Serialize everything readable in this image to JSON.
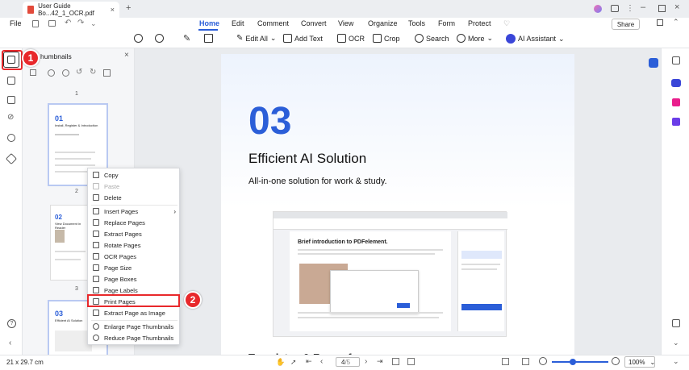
{
  "window": {
    "tab_title": "User Guide Bo...42_1_OCR.pdf"
  },
  "menubar": {
    "file": "File",
    "items": [
      "Home",
      "Edit",
      "Comment",
      "Convert",
      "View",
      "Organize",
      "Tools",
      "Form",
      "Protect"
    ],
    "active": "Home",
    "share": "Share"
  },
  "toolbar": {
    "edit_all": "Edit All",
    "add_text": "Add Text",
    "ocr": "OCR",
    "crop": "Crop",
    "search": "Search",
    "more": "More",
    "ai_assistant": "AI Assistant"
  },
  "thumbnails": {
    "title": "Thumbnails",
    "title_visible": "humbnails",
    "page_labels": [
      "1",
      "2",
      "3"
    ],
    "thumb1": {
      "num": "01",
      "title": "Install, Register & Introduction"
    },
    "thumb2": {
      "num": "02",
      "title": "View Document in Reader"
    },
    "thumb3": {
      "num": "03",
      "title": "Efficient AI Solution"
    }
  },
  "context_menu": {
    "items": [
      "Copy",
      "Paste",
      "Delete",
      "Insert Pages",
      "Replace Pages",
      "Extract Pages",
      "Rotate Pages",
      "OCR Pages",
      "Page Size",
      "Page Boxes",
      "Page Labels",
      "Print Pages",
      "Extract Page as Image",
      "Enlarge Page Thumbnails",
      "Reduce Page Thumbnails"
    ],
    "disabled": [
      "Paste"
    ],
    "highlighted": "Print Pages"
  },
  "badges": {
    "one": "1",
    "two": "2"
  },
  "page": {
    "number": "03",
    "title": "Efficient AI Solution",
    "subtitle": "All-in-one solution for work & study.",
    "inner_heading": "Brief introduction to PDFelement.",
    "bottom_heading_partial": "Templates & Forms for"
  },
  "status": {
    "page_size": "21 x 29.7 cm",
    "current_page": "4",
    "total_pages": "/5",
    "zoom": "100%"
  },
  "colors": {
    "accent": "#2b5ed8",
    "badge_red": "#e8282b",
    "highlight_red": "#e8282b"
  }
}
